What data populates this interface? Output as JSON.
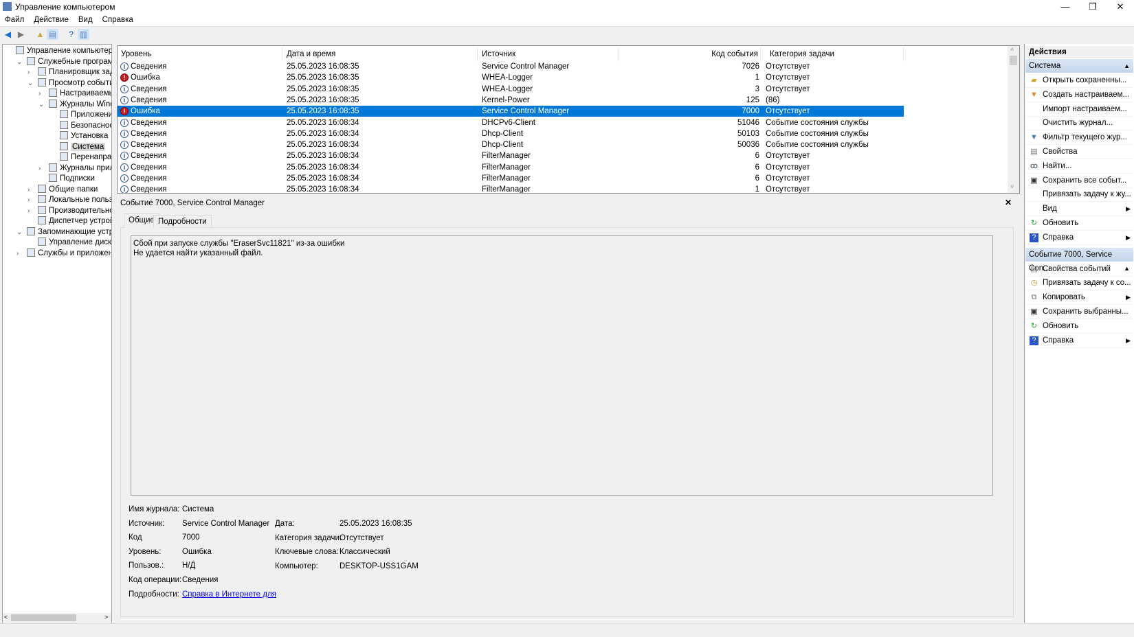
{
  "window": {
    "title": "Управление компьютером",
    "minimize": "—",
    "restore": "❐",
    "close": "✕"
  },
  "menu": [
    "Файл",
    "Действие",
    "Вид",
    "Справка"
  ],
  "toolbar": [
    "back-icon",
    "forward-icon",
    "up-folder-icon",
    "show-hide-tree-icon",
    "help-icon",
    "show-hide-action-pane-icon"
  ],
  "tree": [
    {
      "label": "Управление компьютером (л",
      "level": 0,
      "exp": "",
      "icon": "computer-management-icon"
    },
    {
      "label": "Служебные программы",
      "level": 1,
      "exp": "v",
      "icon": "tools-icon"
    },
    {
      "label": "Планировщик заданий",
      "level": 2,
      "exp": ">",
      "icon": "clock-icon"
    },
    {
      "label": "Просмотр событий",
      "level": 2,
      "exp": "v",
      "icon": "event-viewer-icon"
    },
    {
      "label": "Настраиваемые пр",
      "level": 3,
      "exp": ">",
      "icon": "folder-icon"
    },
    {
      "label": "Журналы Windows",
      "level": 3,
      "exp": "v",
      "icon": "folder-icon"
    },
    {
      "label": "Приложение",
      "level": 4,
      "exp": "",
      "icon": "log-icon"
    },
    {
      "label": "Безопасность",
      "level": 4,
      "exp": "",
      "icon": "log-icon"
    },
    {
      "label": "Установка",
      "level": 4,
      "exp": "",
      "icon": "log-icon"
    },
    {
      "label": "Система",
      "level": 4,
      "exp": "",
      "icon": "log-icon",
      "selected": true
    },
    {
      "label": "Перенаправлен",
      "level": 4,
      "exp": "",
      "icon": "log-icon"
    },
    {
      "label": "Журналы приложе",
      "level": 3,
      "exp": ">",
      "icon": "folder-icon"
    },
    {
      "label": "Подписки",
      "level": 3,
      "exp": "",
      "icon": "subscriptions-icon"
    },
    {
      "label": "Общие папки",
      "level": 2,
      "exp": ">",
      "icon": "shared-folder-icon"
    },
    {
      "label": "Локальные пользовате",
      "level": 2,
      "exp": ">",
      "icon": "users-icon"
    },
    {
      "label": "Производительность",
      "level": 2,
      "exp": ">",
      "icon": "performance-icon"
    },
    {
      "label": "Диспетчер устройств",
      "level": 2,
      "exp": "",
      "icon": "device-manager-icon"
    },
    {
      "label": "Запоминающие устройст",
      "level": 1,
      "exp": "v",
      "icon": "storage-icon"
    },
    {
      "label": "Управление дисками",
      "level": 2,
      "exp": "",
      "icon": "disk-icon"
    },
    {
      "label": "Службы и приложения",
      "level": 1,
      "exp": ">",
      "icon": "services-icon"
    }
  ],
  "table": {
    "columns": [
      "Уровень",
      "Дата и время",
      "Источник",
      "Код события",
      "Категория задачи"
    ],
    "rows": [
      [
        "Сведения",
        "25.05.2023 16:08:35",
        "Service Control Manager",
        "7026",
        "Отсутствует"
      ],
      [
        "Ошибка",
        "25.05.2023 16:08:35",
        "WHEA-Logger",
        "1",
        "Отсутствует"
      ],
      [
        "Сведения",
        "25.05.2023 16:08:35",
        "WHEA-Logger",
        "3",
        "Отсутствует"
      ],
      [
        "Сведения",
        "25.05.2023 16:08:35",
        "Kernel-Power",
        "125",
        "(86)"
      ],
      [
        "Ошибка",
        "25.05.2023 16:08:35",
        "Service Control Manager",
        "7000",
        "Отсутствует"
      ],
      [
        "Сведения",
        "25.05.2023 16:08:34",
        "DHCPv6-Client",
        "51046",
        "Событие состояния службы"
      ],
      [
        "Сведения",
        "25.05.2023 16:08:34",
        "Dhcp-Client",
        "50103",
        "Событие состояния службы"
      ],
      [
        "Сведения",
        "25.05.2023 16:08:34",
        "Dhcp-Client",
        "50036",
        "Событие состояния службы"
      ],
      [
        "Сведения",
        "25.05.2023 16:08:34",
        "FilterManager",
        "6",
        "Отсутствует"
      ],
      [
        "Сведения",
        "25.05.2023 16:08:34",
        "FilterManager",
        "6",
        "Отсутствует"
      ],
      [
        "Сведения",
        "25.05.2023 16:08:34",
        "FilterManager",
        "6",
        "Отсутствует"
      ],
      [
        "Сведения",
        "25.05.2023 16:08:34",
        "FilterManager",
        "1",
        "Отсутствует"
      ]
    ],
    "selected_row": 4
  },
  "details": {
    "header": "Событие 7000, Service Control Manager",
    "close": "✕",
    "tabs": [
      "Общие",
      "Подробности"
    ],
    "message_lines": [
      "Сбой при запуске службы \"EraserSvc11821\" из-за ошибки",
      "Не удается найти указанный файл."
    ],
    "fields_left": [
      [
        "Имя журнала:",
        "Система"
      ],
      [
        "Источник:",
        "Service Control Manager"
      ],
      [
        "Код",
        "7000"
      ],
      [
        "Уровень:",
        "Ошибка"
      ],
      [
        "Пользов.:",
        "Н/Д"
      ],
      [
        "Код операции:",
        "Сведения"
      ],
      [
        "Подробности:",
        "Справка в Интернете для"
      ]
    ],
    "fields_right": [
      [
        "Дата:",
        "25.05.2023 16:08:35"
      ],
      [
        "Категория задачи:",
        "Отсутствует"
      ],
      [
        "Ключевые слова:",
        "Классический"
      ],
      [
        "Компьютер:",
        "DESKTOP-USS1GAM"
      ]
    ],
    "link_color": "#0000ee"
  },
  "actions": {
    "title": "Действия",
    "sections": [
      {
        "title": "Система",
        "items": [
          {
            "label": "Открыть сохраненны...",
            "icon": "open-folder-icon"
          },
          {
            "label": "Создать настраиваем...",
            "icon": "create-filter-icon"
          },
          {
            "label": "Импорт настраиваем...",
            "icon": ""
          },
          {
            "label": "Очистить журнал...",
            "icon": ""
          },
          {
            "label": "Фильтр текущего жур...",
            "icon": "filter-icon"
          },
          {
            "label": "Свойства",
            "icon": "properties-icon"
          },
          {
            "label": "Найти...",
            "icon": "find-icon"
          },
          {
            "label": "Сохранить все событ...",
            "icon": "save-icon"
          },
          {
            "label": "Привязать задачу к жу...",
            "icon": ""
          },
          {
            "label": "Вид",
            "icon": "",
            "submenu": true
          },
          {
            "label": "Обновить",
            "icon": "refresh-icon"
          },
          {
            "label": "Справка",
            "icon": "help-icon",
            "submenu": true
          }
        ]
      },
      {
        "title": "Событие 7000, Service Con...",
        "items": [
          {
            "label": "Свойства событий",
            "icon": "event-properties-icon"
          },
          {
            "label": "Привязать задачу к со...",
            "icon": "attach-task-icon"
          },
          {
            "label": "Копировать",
            "icon": "copy-icon",
            "submenu": true
          },
          {
            "label": "Сохранить выбранны...",
            "icon": "save-icon"
          },
          {
            "label": "Обновить",
            "icon": "refresh-icon"
          },
          {
            "label": "Справка",
            "icon": "help-icon",
            "submenu": true
          }
        ]
      }
    ]
  },
  "colors": {
    "selection": "#0078d7",
    "error": "#c8202a",
    "section_header": "#c4d6ec"
  }
}
